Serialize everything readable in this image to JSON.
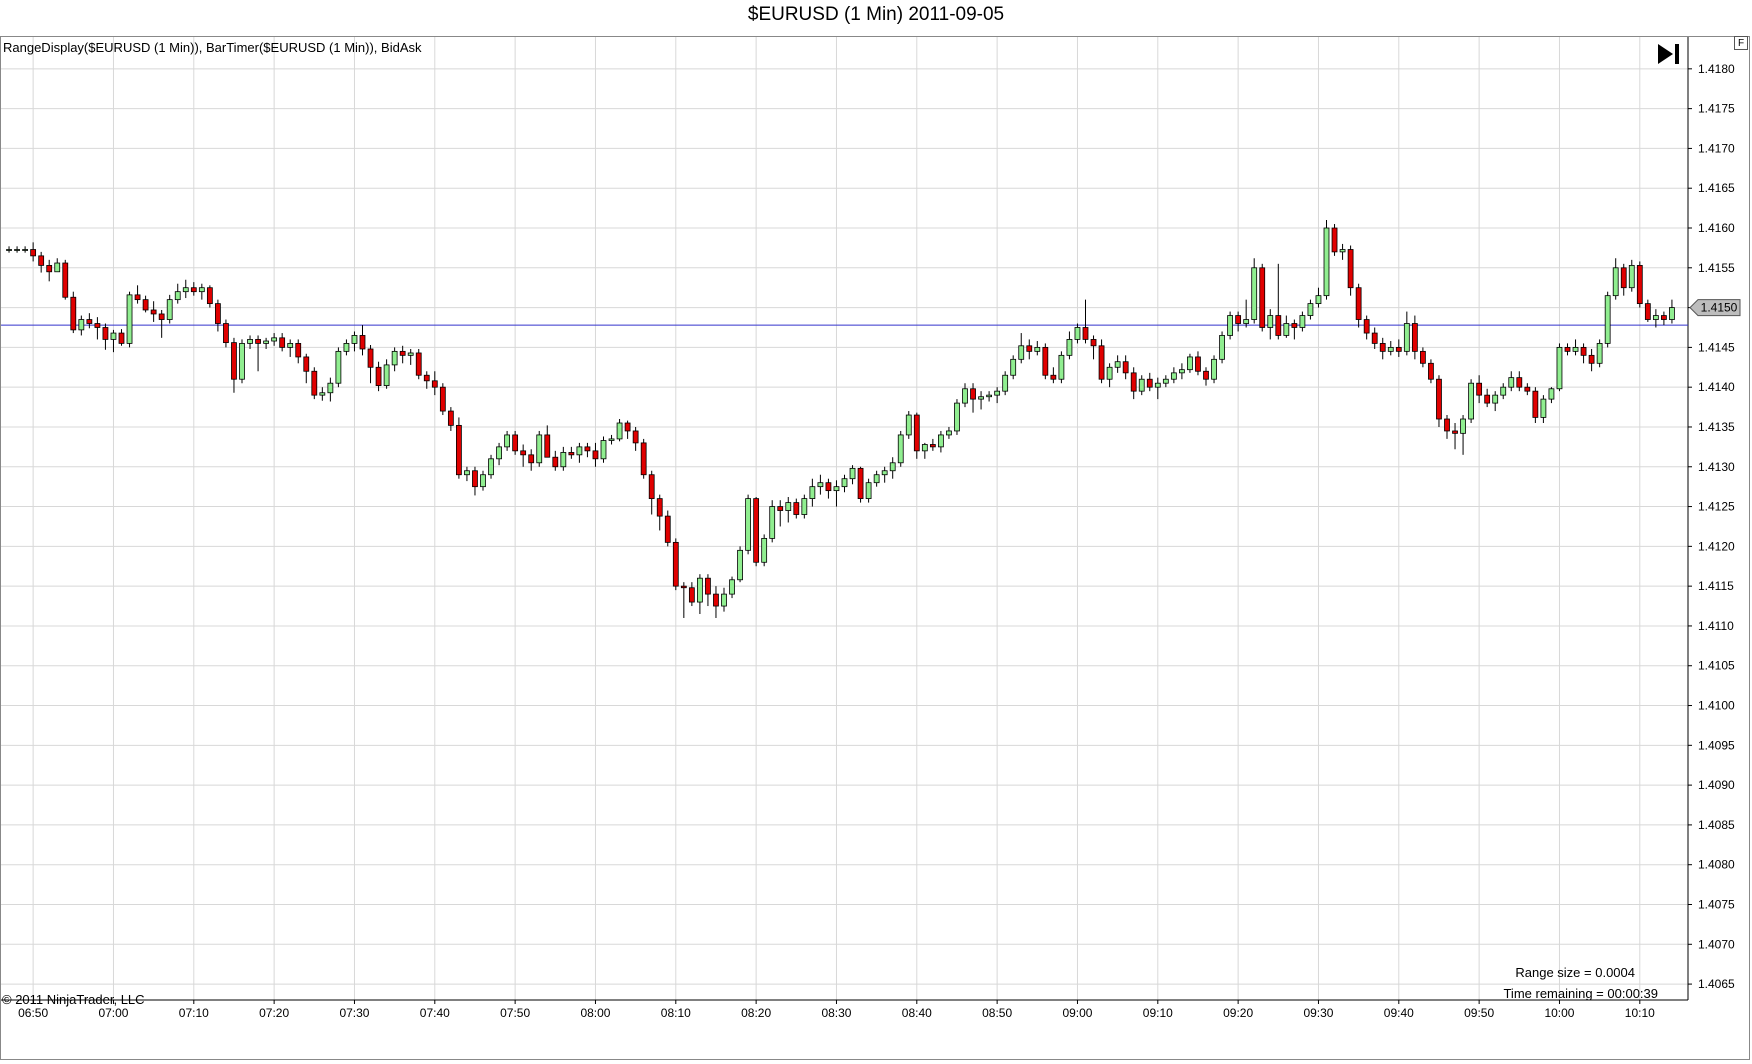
{
  "chart_data": {
    "type": "candlestick",
    "title": "$EURUSD (1 Min)  2011-09-05",
    "indicators": "RangeDisplay($EURUSD (1 Min)),  BarTimer($EURUSD (1 Min)),  BidAsk",
    "copyright": "© 2011 NinjaTrader, LLC",
    "range_size_text": "Range size = 0.0004",
    "time_remaining_text": "Time remaining = 00:00:39",
    "y_ticks": [
      "1.4180",
      "1.4175",
      "1.4170",
      "1.4165",
      "1.4160",
      "1.4155",
      "1.4150",
      "1.4145",
      "1.4140",
      "1.4135",
      "1.4130",
      "1.4125",
      "1.4120",
      "1.4115",
      "1.4110",
      "1.4105",
      "1.4100",
      "1.4095",
      "1.4090",
      "1.4085",
      "1.4080",
      "1.4075",
      "1.4070",
      "1.4065"
    ],
    "x_ticks": [
      "06:50",
      "07:00",
      "07:10",
      "07:20",
      "07:30",
      "07:40",
      "07:50",
      "08:00",
      "08:10",
      "08:20",
      "08:30",
      "08:40",
      "08:50",
      "09:00",
      "09:10",
      "09:20",
      "09:30",
      "09:40",
      "09:50",
      "10:00",
      "10:10"
    ],
    "ylim": [
      1.4063,
      1.4184
    ],
    "xlim_minutes_from_0650": [
      -4,
      206
    ],
    "last_price": 1.415,
    "last_price_label": "1.4150",
    "bid_line": 1.41478,
    "grid": true,
    "up_color": "#90ee90",
    "down_color": "#e00000",
    "bid_line_color": "#3333cc",
    "start_time": "06:47",
    "candles": [
      [
        1.41573,
        1.41577,
        1.41569,
        1.41573
      ],
      [
        1.41573,
        1.41577,
        1.41569,
        1.41573
      ],
      [
        1.41573,
        1.41577,
        1.41569,
        1.41573
      ],
      [
        1.41573,
        1.41582,
        1.41558,
        1.41565
      ],
      [
        1.41565,
        1.4157,
        1.41544,
        1.41553
      ],
      [
        1.41553,
        1.4156,
        1.41533,
        1.41545
      ],
      [
        1.41545,
        1.41562,
        1.41545,
        1.41556
      ],
      [
        1.41556,
        1.4156,
        1.4151,
        1.41513
      ],
      [
        1.41513,
        1.4152,
        1.41468,
        1.41472
      ],
      [
        1.41472,
        1.4149,
        1.41465,
        1.41485
      ],
      [
        1.41485,
        1.41493,
        1.41474,
        1.4148
      ],
      [
        1.4148,
        1.41488,
        1.4146,
        1.41475
      ],
      [
        1.41475,
        1.4148,
        1.41447,
        1.4146
      ],
      [
        1.4146,
        1.41472,
        1.41444,
        1.41468
      ],
      [
        1.41468,
        1.41473,
        1.41452,
        1.41455
      ],
      [
        1.41455,
        1.4152,
        1.4145,
        1.41516
      ],
      [
        1.41516,
        1.41528,
        1.41505,
        1.4151
      ],
      [
        1.4151,
        1.41515,
        1.41494,
        1.41497
      ],
      [
        1.41497,
        1.41508,
        1.41482,
        1.41492
      ],
      [
        1.41492,
        1.41497,
        1.41462,
        1.41485
      ],
      [
        1.41485,
        1.41516,
        1.4148,
        1.4151
      ],
      [
        1.4151,
        1.4153,
        1.41505,
        1.4152
      ],
      [
        1.4152,
        1.41535,
        1.41512,
        1.41525
      ],
      [
        1.41525,
        1.41532,
        1.41515,
        1.4152
      ],
      [
        1.4152,
        1.4153,
        1.4151,
        1.41525
      ],
      [
        1.41525,
        1.41528,
        1.415,
        1.41505
      ],
      [
        1.41505,
        1.4151,
        1.4147,
        1.4148
      ],
      [
        1.4148,
        1.41485,
        1.4145,
        1.41456
      ],
      [
        1.41456,
        1.41462,
        1.41393,
        1.4141
      ],
      [
        1.4141,
        1.4146,
        1.41405,
        1.41455
      ],
      [
        1.41455,
        1.41465,
        1.41448,
        1.4146
      ],
      [
        1.4146,
        1.41465,
        1.4142,
        1.41455
      ],
      [
        1.41455,
        1.41462,
        1.41448,
        1.41458
      ],
      [
        1.41458,
        1.41468,
        1.41452,
        1.41462
      ],
      [
        1.41462,
        1.41468,
        1.41445,
        1.4145
      ],
      [
        1.4145,
        1.4146,
        1.41438,
        1.41455
      ],
      [
        1.41455,
        1.4146,
        1.4143,
        1.41438
      ],
      [
        1.41438,
        1.41442,
        1.41405,
        1.4142
      ],
      [
        1.4142,
        1.41425,
        1.41385,
        1.4139
      ],
      [
        1.4139,
        1.414,
        1.41383,
        1.41393
      ],
      [
        1.41393,
        1.41412,
        1.41382,
        1.41405
      ],
      [
        1.41405,
        1.4145,
        1.414,
        1.41445
      ],
      [
        1.41445,
        1.4146,
        1.4144,
        1.41455
      ],
      [
        1.41455,
        1.4147,
        1.41445,
        1.41465
      ],
      [
        1.41465,
        1.41478,
        1.4144,
        1.41448
      ],
      [
        1.41448,
        1.41453,
        1.41405,
        1.41425
      ],
      [
        1.41425,
        1.41432,
        1.41395,
        1.41402
      ],
      [
        1.41402,
        1.41435,
        1.41398,
        1.41428
      ],
      [
        1.41428,
        1.4145,
        1.4142,
        1.41445
      ],
      [
        1.41445,
        1.41452,
        1.4143,
        1.4144
      ],
      [
        1.4144,
        1.41448,
        1.41428,
        1.41443
      ],
      [
        1.41443,
        1.41448,
        1.4141,
        1.41415
      ],
      [
        1.41415,
        1.4142,
        1.41398,
        1.41408
      ],
      [
        1.41408,
        1.4142,
        1.4139,
        1.414
      ],
      [
        1.414,
        1.41405,
        1.41365,
        1.4137
      ],
      [
        1.4137,
        1.41375,
        1.41345,
        1.41352
      ],
      [
        1.41352,
        1.41362,
        1.41285,
        1.4129
      ],
      [
        1.4129,
        1.413,
        1.41282,
        1.41295
      ],
      [
        1.41295,
        1.413,
        1.41264,
        1.41275
      ],
      [
        1.41275,
        1.41295,
        1.4127,
        1.4129
      ],
      [
        1.4129,
        1.41315,
        1.41285,
        1.4131
      ],
      [
        1.4131,
        1.4133,
        1.41302,
        1.41325
      ],
      [
        1.41325,
        1.41345,
        1.4132,
        1.4134
      ],
      [
        1.4134,
        1.41345,
        1.41315,
        1.4132
      ],
      [
        1.4132,
        1.41328,
        1.413,
        1.41315
      ],
      [
        1.41315,
        1.41322,
        1.41295,
        1.41305
      ],
      [
        1.41305,
        1.41345,
        1.413,
        1.4134
      ],
      [
        1.4134,
        1.41352,
        1.4133,
        1.41312
      ],
      [
        1.41312,
        1.4132,
        1.41295,
        1.413
      ],
      [
        1.413,
        1.41325,
        1.41295,
        1.41318
      ],
      [
        1.41318,
        1.41325,
        1.4131,
        1.41315
      ],
      [
        1.41315,
        1.4133,
        1.41305,
        1.41325
      ],
      [
        1.41325,
        1.4133,
        1.41312,
        1.4132
      ],
      [
        1.4132,
        1.4133,
        1.413,
        1.4131
      ],
      [
        1.4131,
        1.41338,
        1.41305,
        1.41333
      ],
      [
        1.41333,
        1.4134,
        1.41328,
        1.41335
      ],
      [
        1.41335,
        1.4136,
        1.41332,
        1.41355
      ],
      [
        1.41355,
        1.41358,
        1.41335,
        1.41345
      ],
      [
        1.41345,
        1.4135,
        1.4132,
        1.4133
      ],
      [
        1.4133,
        1.41335,
        1.41285,
        1.4129
      ],
      [
        1.4129,
        1.41295,
        1.4124,
        1.4126
      ],
      [
        1.4126,
        1.41265,
        1.4122,
        1.41238
      ],
      [
        1.41238,
        1.41245,
        1.412,
        1.41205
      ],
      [
        1.41205,
        1.4121,
        1.41145,
        1.4115
      ],
      [
        1.4115,
        1.41155,
        1.4111,
        1.41148
      ],
      [
        1.41148,
        1.41155,
        1.41125,
        1.4113
      ],
      [
        1.4113,
        1.41165,
        1.41115,
        1.4116
      ],
      [
        1.4116,
        1.41165,
        1.41125,
        1.4114
      ],
      [
        1.4114,
        1.4115,
        1.4111,
        1.41125
      ],
      [
        1.41125,
        1.41148,
        1.41118,
        1.4114
      ],
      [
        1.4114,
        1.41162,
        1.41135,
        1.41158
      ],
      [
        1.41158,
        1.412,
        1.41155,
        1.41195
      ],
      [
        1.41195,
        1.41265,
        1.4119,
        1.4126
      ],
      [
        1.4126,
        1.41262,
        1.41175,
        1.4118
      ],
      [
        1.4118,
        1.41215,
        1.41175,
        1.4121
      ],
      [
        1.4121,
        1.41258,
        1.41205,
        1.4125
      ],
      [
        1.4125,
        1.41258,
        1.41225,
        1.41245
      ],
      [
        1.41245,
        1.41262,
        1.4123,
        1.41255
      ],
      [
        1.41255,
        1.4126,
        1.41235,
        1.4124
      ],
      [
        1.4124,
        1.41265,
        1.41235,
        1.4126
      ],
      [
        1.4126,
        1.41285,
        1.4125,
        1.41275
      ],
      [
        1.41275,
        1.4129,
        1.41265,
        1.4128
      ],
      [
        1.4128,
        1.41285,
        1.4126,
        1.4127
      ],
      [
        1.4127,
        1.41283,
        1.4125,
        1.41275
      ],
      [
        1.41275,
        1.4129,
        1.41268,
        1.41285
      ],
      [
        1.41285,
        1.41302,
        1.41278,
        1.41298
      ],
      [
        1.41298,
        1.413,
        1.41255,
        1.4126
      ],
      [
        1.4126,
        1.41285,
        1.41255,
        1.4128
      ],
      [
        1.4128,
        1.41295,
        1.41275,
        1.4129
      ],
      [
        1.4129,
        1.413,
        1.4128,
        1.41295
      ],
      [
        1.41295,
        1.41312,
        1.41285,
        1.41305
      ],
      [
        1.41305,
        1.41345,
        1.413,
        1.4134
      ],
      [
        1.4134,
        1.4137,
        1.41335,
        1.41365
      ],
      [
        1.41365,
        1.41368,
        1.4131,
        1.4132
      ],
      [
        1.4132,
        1.4133,
        1.4131,
        1.41328
      ],
      [
        1.41328,
        1.41335,
        1.4132,
        1.41325
      ],
      [
        1.41325,
        1.41345,
        1.41318,
        1.4134
      ],
      [
        1.4134,
        1.4135,
        1.41335,
        1.41345
      ],
      [
        1.41345,
        1.41385,
        1.4134,
        1.4138
      ],
      [
        1.4138,
        1.41405,
        1.41375,
        1.41398
      ],
      [
        1.41398,
        1.41405,
        1.41368,
        1.41385
      ],
      [
        1.41385,
        1.41395,
        1.41372,
        1.41388
      ],
      [
        1.41388,
        1.41395,
        1.41382,
        1.4139
      ],
      [
        1.4139,
        1.414,
        1.4138,
        1.41395
      ],
      [
        1.41395,
        1.4142,
        1.4139,
        1.41415
      ],
      [
        1.41415,
        1.4144,
        1.4141,
        1.41435
      ],
      [
        1.41435,
        1.41468,
        1.4143,
        1.41452
      ],
      [
        1.41452,
        1.4146,
        1.41435,
        1.41445
      ],
      [
        1.41445,
        1.41458,
        1.4144,
        1.4145
      ],
      [
        1.4145,
        1.41455,
        1.4141,
        1.41415
      ],
      [
        1.41415,
        1.41425,
        1.41405,
        1.4141
      ],
      [
        1.4141,
        1.41445,
        1.41405,
        1.4144
      ],
      [
        1.4144,
        1.4147,
        1.41435,
        1.4146
      ],
      [
        1.4146,
        1.4148,
        1.41455,
        1.41475
      ],
      [
        1.41475,
        1.4151,
        1.41455,
        1.4146
      ],
      [
        1.4146,
        1.41465,
        1.41435,
        1.41452
      ],
      [
        1.41452,
        1.4146,
        1.41405,
        1.4141
      ],
      [
        1.4141,
        1.4143,
        1.414,
        1.41425
      ],
      [
        1.41425,
        1.4144,
        1.41418,
        1.41432
      ],
      [
        1.41432,
        1.4144,
        1.4141,
        1.41418
      ],
      [
        1.41418,
        1.41425,
        1.41385,
        1.41395
      ],
      [
        1.41395,
        1.41415,
        1.4139,
        1.4141
      ],
      [
        1.4141,
        1.41418,
        1.41395,
        1.414
      ],
      [
        1.414,
        1.41412,
        1.41385,
        1.41405
      ],
      [
        1.41405,
        1.41415,
        1.414,
        1.4141
      ],
      [
        1.4141,
        1.41425,
        1.41405,
        1.41418
      ],
      [
        1.41418,
        1.4143,
        1.4141,
        1.41422
      ],
      [
        1.41422,
        1.41442,
        1.41418,
        1.41438
      ],
      [
        1.41438,
        1.41445,
        1.41415,
        1.4142
      ],
      [
        1.4142,
        1.41425,
        1.41402,
        1.4141
      ],
      [
        1.4141,
        1.4144,
        1.41405,
        1.41435
      ],
      [
        1.41435,
        1.4147,
        1.4143,
        1.41465
      ],
      [
        1.41465,
        1.41495,
        1.4146,
        1.4149
      ],
      [
        1.4149,
        1.41495,
        1.4147,
        1.4148
      ],
      [
        1.4148,
        1.4151,
        1.41475,
        1.41485
      ],
      [
        1.41485,
        1.41562,
        1.4148,
        1.4155
      ],
      [
        1.4155,
        1.41555,
        1.4147,
        1.41475
      ],
      [
        1.41475,
        1.41498,
        1.4146,
        1.4149
      ],
      [
        1.4149,
        1.41555,
        1.4146,
        1.41465
      ],
      [
        1.41465,
        1.4149,
        1.41462,
        1.4148
      ],
      [
        1.4148,
        1.41485,
        1.4146,
        1.41475
      ],
      [
        1.41475,
        1.41495,
        1.4147,
        1.4149
      ],
      [
        1.4149,
        1.4151,
        1.41485,
        1.41505
      ],
      [
        1.41505,
        1.41525,
        1.415,
        1.41515
      ],
      [
        1.41515,
        1.4161,
        1.4151,
        1.416
      ],
      [
        1.416,
        1.41605,
        1.41565,
        1.4157
      ],
      [
        1.4157,
        1.4158,
        1.4156,
        1.41573
      ],
      [
        1.41573,
        1.41578,
        1.41515,
        1.41525
      ],
      [
        1.41525,
        1.4153,
        1.41475,
        1.41485
      ],
      [
        1.41485,
        1.4149,
        1.4146,
        1.41468
      ],
      [
        1.41468,
        1.41475,
        1.41448,
        1.41455
      ],
      [
        1.41455,
        1.41462,
        1.41435,
        1.41445
      ],
      [
        1.41445,
        1.41458,
        1.4144,
        1.4145
      ],
      [
        1.4145,
        1.4146,
        1.41438,
        1.41445
      ],
      [
        1.41445,
        1.41495,
        1.4144,
        1.4148
      ],
      [
        1.4148,
        1.4149,
        1.41435,
        1.41445
      ],
      [
        1.41445,
        1.4145,
        1.41425,
        1.4143
      ],
      [
        1.4143,
        1.41435,
        1.41405,
        1.4141
      ],
      [
        1.4141,
        1.41415,
        1.4135,
        1.4136
      ],
      [
        1.4136,
        1.41365,
        1.41335,
        1.41345
      ],
      [
        1.41345,
        1.41355,
        1.41322,
        1.41342
      ],
      [
        1.41342,
        1.41365,
        1.41315,
        1.4136
      ],
      [
        1.4136,
        1.4141,
        1.41355,
        1.41405
      ],
      [
        1.41405,
        1.41415,
        1.4138,
        1.4139
      ],
      [
        1.4139,
        1.41398,
        1.41375,
        1.4138
      ],
      [
        1.4138,
        1.41395,
        1.4137,
        1.4139
      ],
      [
        1.4139,
        1.41405,
        1.41385,
        1.414
      ],
      [
        1.414,
        1.4142,
        1.41395,
        1.41412
      ],
      [
        1.41412,
        1.4142,
        1.41395,
        1.414
      ],
      [
        1.414,
        1.41405,
        1.4139,
        1.41395
      ],
      [
        1.41395,
        1.414,
        1.41355,
        1.41362
      ],
      [
        1.41362,
        1.4139,
        1.41355,
        1.41385
      ],
      [
        1.41385,
        1.414,
        1.4138,
        1.41398
      ],
      [
        1.41398,
        1.41455,
        1.41395,
        1.4145
      ],
      [
        1.4145,
        1.41455,
        1.4144,
        1.41445
      ],
      [
        1.41445,
        1.4146,
        1.4144,
        1.4145
      ],
      [
        1.4145,
        1.41455,
        1.4143,
        1.4144
      ],
      [
        1.4144,
        1.41448,
        1.4142,
        1.4143
      ],
      [
        1.4143,
        1.4146,
        1.41425,
        1.41455
      ],
      [
        1.41455,
        1.4152,
        1.4145,
        1.41515
      ],
      [
        1.41515,
        1.41562,
        1.4151,
        1.4155
      ],
      [
        1.4155,
        1.41555,
        1.41515,
        1.41525
      ],
      [
        1.41525,
        1.4156,
        1.4152,
        1.41553
      ],
      [
        1.41553,
        1.41558,
        1.415,
        1.41505
      ],
      [
        1.41505,
        1.4151,
        1.41482,
        1.41485
      ],
      [
        1.41485,
        1.41498,
        1.41475,
        1.4149
      ],
      [
        1.4149,
        1.41495,
        1.41478,
        1.41485
      ],
      [
        1.41485,
        1.4151,
        1.4148,
        1.415
      ]
    ]
  }
}
